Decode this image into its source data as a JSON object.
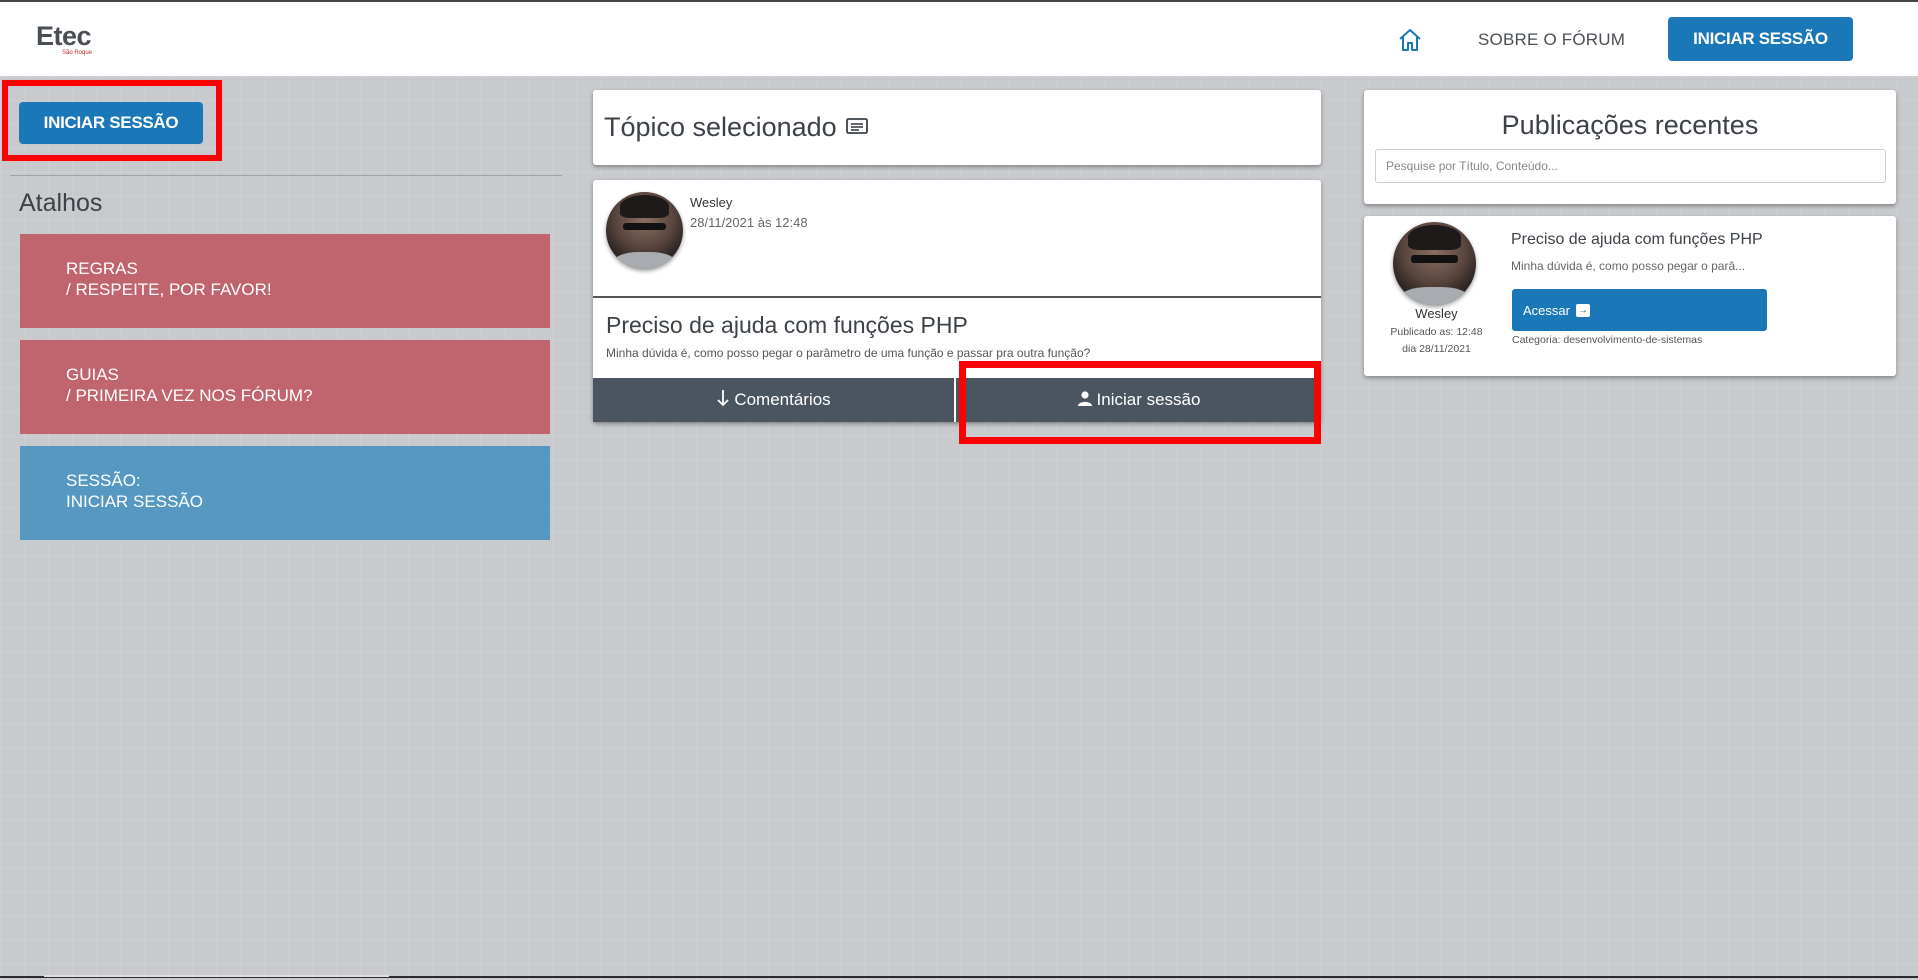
{
  "header": {
    "logo_main": "Etec",
    "logo_sub": "São Roque",
    "home_icon": "home-icon",
    "about_link": "SOBRE O FÓRUM",
    "login_button": "INICIAR SESSÃO"
  },
  "sidebar": {
    "login_button": "INICIAR SESSÃO",
    "shortcuts_title": "Atalhos",
    "shortcuts": [
      {
        "line1": "REGRAS",
        "line2": "/ RESPEITE, POR FAVOR!",
        "color": "#c0656e"
      },
      {
        "line1": "GUIAS",
        "line2": "/ PRIMEIRA VEZ NOS FÓRUM?",
        "color": "#c0656e"
      },
      {
        "line1": "SESSÃO:",
        "line2": "INICIAR SESSÃO",
        "color": "#5798c2"
      }
    ]
  },
  "topic": {
    "title": "Tópico selecionado",
    "title_icon": "article-icon"
  },
  "post": {
    "author": "Wesley",
    "date": "28/11/2021 às 12:48",
    "title": "Preciso de ajuda com funções PHP",
    "body": "Minha dúvida é, como posso pegar o parâmetro de uma função e passar pra outra função?",
    "comments_button": "Comentários",
    "login_button": "Iniciar sessão"
  },
  "recent": {
    "title": "Publicações recentes",
    "search_placeholder": "Pesquise por Título, Conteúdo...",
    "items": [
      {
        "author": "Wesley",
        "published_time": "Publicado as: 12:48",
        "published_date": "dia 28/11/2021",
        "title": "Preciso de ajuda com funções PHP",
        "excerpt": "Minha dúvida é, como posso pegar o parâ...",
        "button": "Acessar",
        "category": "Categoria: desenvolvimento-de-sistemas"
      }
    ]
  },
  "colors": {
    "accent": "#1a78b8",
    "rule_red": "#c0656e",
    "session_blue": "#5798c2",
    "action_dark": "#4a5560",
    "highlight": "#ff0000"
  }
}
